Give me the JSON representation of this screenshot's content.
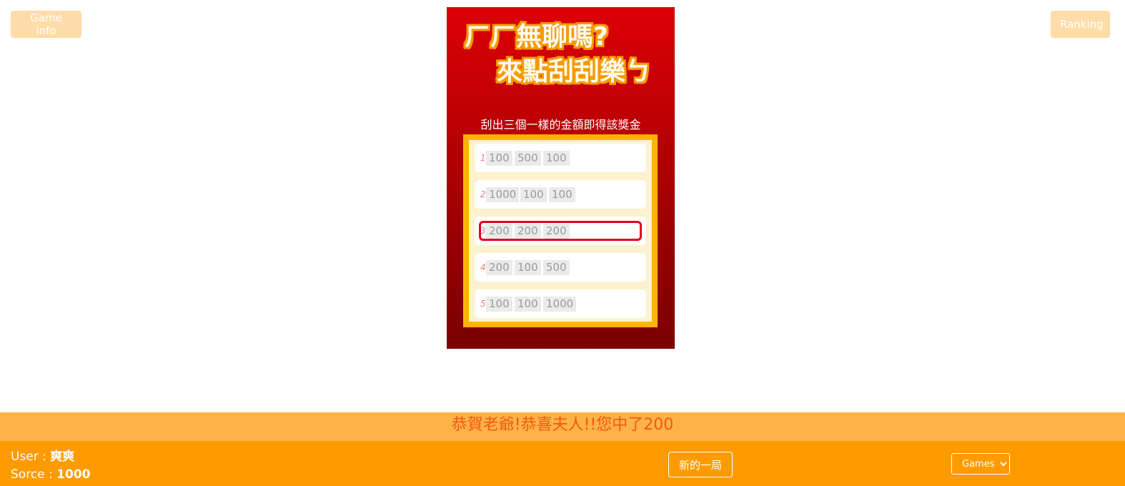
{
  "header": {
    "game_info_label": "Game info",
    "ranking_label": "Ranking"
  },
  "card": {
    "title_line1": "ㄏㄏ無聊嗎?",
    "title_line2": "來點刮刮樂ㄅ",
    "instruction": "刮出三個一樣的金額即得該獎金",
    "rows": [
      {
        "num": "1",
        "values": [
          "100",
          "500",
          "100"
        ],
        "winning": false
      },
      {
        "num": "2",
        "values": [
          "1000",
          "100",
          "100"
        ],
        "winning": false
      },
      {
        "num": "3",
        "values": [
          "200",
          "200",
          "200"
        ],
        "winning": true
      },
      {
        "num": "4",
        "values": [
          "200",
          "100",
          "500"
        ],
        "winning": false
      },
      {
        "num": "5",
        "values": [
          "100",
          "100",
          "1000"
        ],
        "winning": false
      }
    ]
  },
  "banner": {
    "message": "恭賀老爺!恭喜夫人!!您中了200"
  },
  "footer": {
    "user_label": "User : ",
    "user_name": "爽爽",
    "score_label": "Sorce : ",
    "score_value": "1000",
    "new_round_label": "新的一局",
    "games_selected": "Games"
  },
  "colors": {
    "card_top": "#dc0006",
    "card_bottom": "#7a0000",
    "board_border": "#ffb400",
    "highlight": "#e4001b",
    "banner_bg": "#ffb246",
    "banner_text": "#f05a14",
    "footer_bg": "#ff9b00"
  }
}
